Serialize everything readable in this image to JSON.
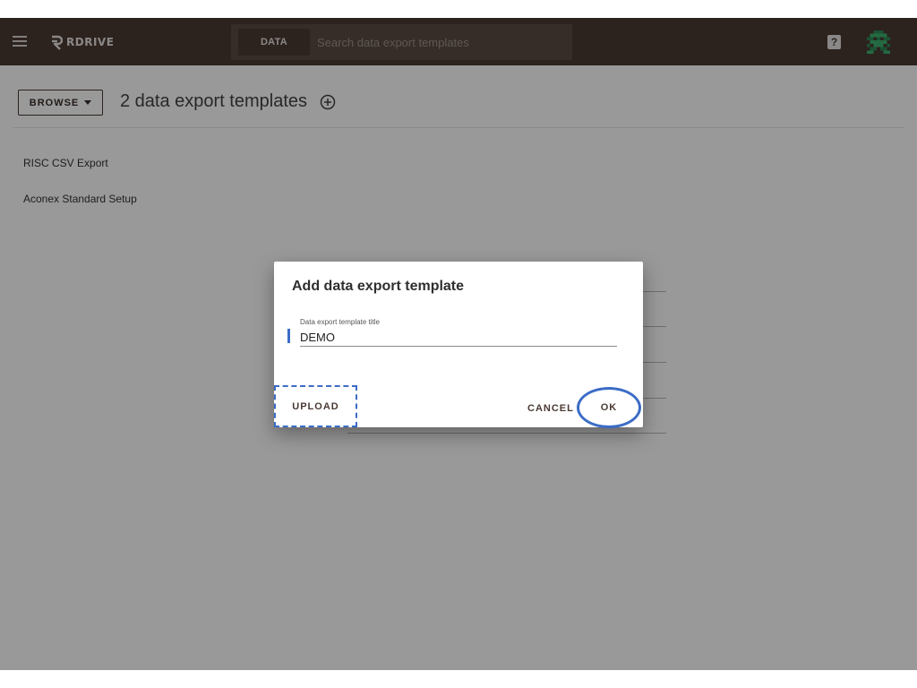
{
  "topbar": {
    "brand": "RDRIVE",
    "search_scope": "DATA",
    "search_placeholder": "Search data export templates",
    "help_glyph": "?"
  },
  "icons": {
    "menu": "hamburger-menu-icon",
    "logo": "rdrive-logo-icon",
    "help": "help-icon",
    "avatar": "pixel-avatar-icon",
    "add": "add-circle-icon",
    "dropdown": "caret-down-icon"
  },
  "header": {
    "browse_label": "BROWSE",
    "title": "2 data export templates"
  },
  "templates": [
    {
      "name": "RISC CSV Export"
    },
    {
      "name": "Aconex Standard Setup"
    }
  ],
  "dialog": {
    "title": "Add data export template",
    "field_label": "Data export template title",
    "field_value": "DEMO",
    "upload_label": "UPLOAD",
    "cancel_label": "CANCEL",
    "ok_label": "OK"
  },
  "colors": {
    "topbar": "#4a3a33",
    "accent": "#3b6cc6"
  }
}
